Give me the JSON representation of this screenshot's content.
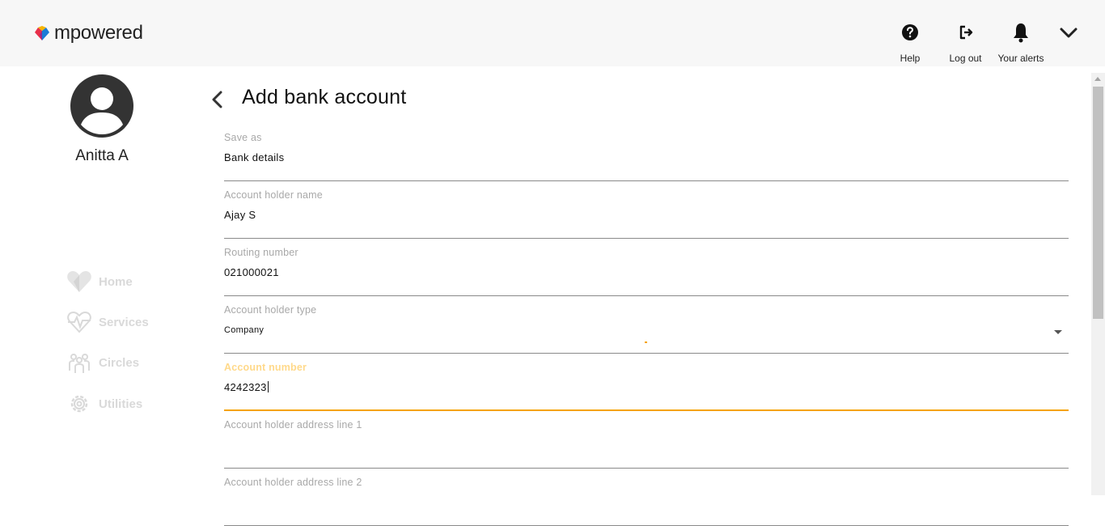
{
  "header": {
    "logo_text": "mpowered",
    "help_label": "Help",
    "logout_label": "Log out",
    "alerts_label": "Your alerts"
  },
  "sidebar": {
    "user_name": "Anitta A",
    "items": [
      {
        "label": "Home",
        "icon": "heart-icon"
      },
      {
        "label": "Services",
        "icon": "heartbeat-icon"
      },
      {
        "label": "Circles",
        "icon": "people-icon"
      },
      {
        "label": "Utilities",
        "icon": "gear-icon"
      }
    ]
  },
  "page": {
    "title": "Add bank account"
  },
  "form": {
    "fields": [
      {
        "label": "Save as",
        "value": "Bank details"
      },
      {
        "label": "Account holder name",
        "value": "Ajay S"
      },
      {
        "label": "Routing number",
        "value": "021000021"
      },
      {
        "label": "Account holder type",
        "value": "Company"
      },
      {
        "label": "Account number",
        "value": "4242323"
      },
      {
        "label": "Account holder address line 1",
        "value": ""
      },
      {
        "label": "Account holder address line 2",
        "value": ""
      }
    ]
  },
  "colors": {
    "accent": "#f5a300",
    "focused_label": "#ffd98a",
    "nav_inactive": "#d9d9d9",
    "header_bg": "#f7f7f7"
  }
}
